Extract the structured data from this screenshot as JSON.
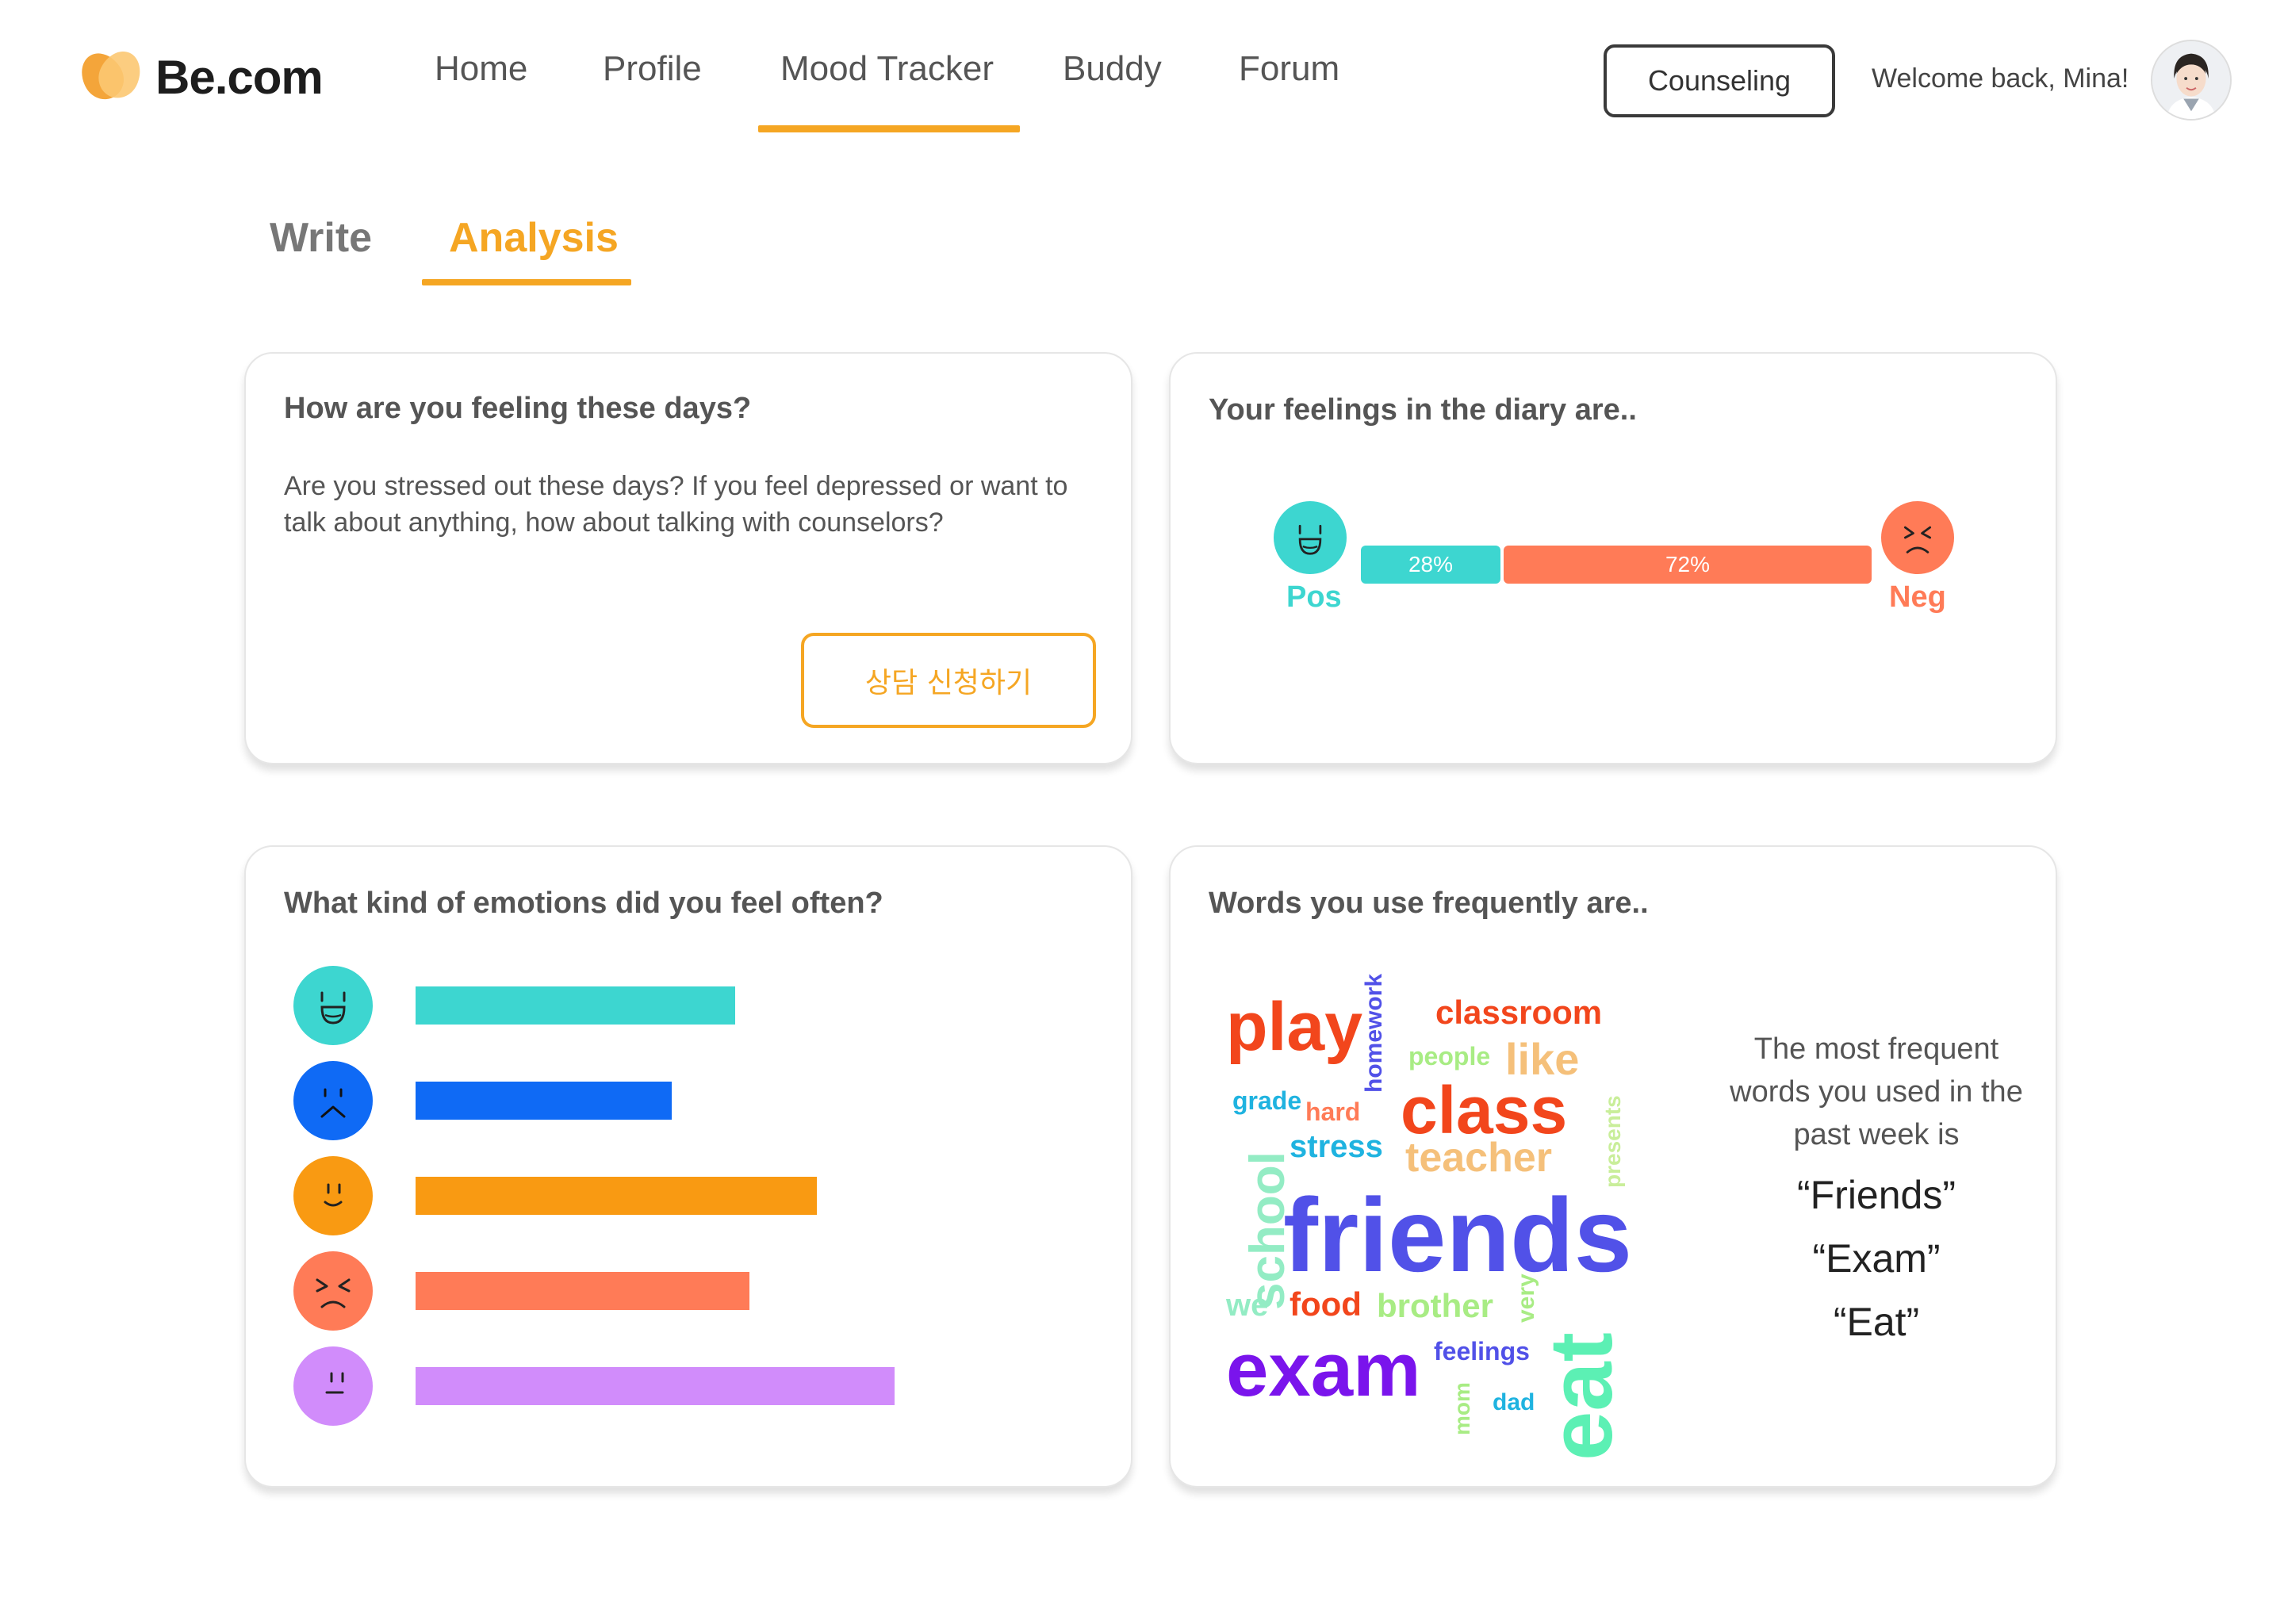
{
  "brand": {
    "name": "Be.com"
  },
  "nav": {
    "items": [
      {
        "label": "Home"
      },
      {
        "label": "Profile"
      },
      {
        "label": "Mood Tracker"
      },
      {
        "label": "Buddy"
      },
      {
        "label": "Forum"
      }
    ],
    "active_index": 2
  },
  "header": {
    "counseling_label": "Counseling",
    "welcome_text": "Welcome back, Mina!"
  },
  "subtabs": {
    "items": [
      {
        "label": "Write"
      },
      {
        "label": "Analysis"
      }
    ],
    "active_index": 1
  },
  "feeling_card": {
    "title": "How are you feeling these days?",
    "description": "Are you stressed out these days? If you feel depressed or want to talk about anything, how about talking with counselors?",
    "button_label": "상담 신청하기"
  },
  "diary_card": {
    "title": "Your feelings in the diary are..",
    "positive": {
      "label": "Pos",
      "percent": 28,
      "percent_text": "28%",
      "color": "#3dd6d0",
      "icon": "grinning-face-icon"
    },
    "negative": {
      "label": "Neg",
      "percent": 72,
      "percent_text": "72%",
      "color": "#ff7b57",
      "icon": "angry-face-icon"
    }
  },
  "emotions_card": {
    "title": "What kind of emotions did you feel often?",
    "chart_data": {
      "type": "bar",
      "orientation": "horizontal",
      "categories": [
        "happy",
        "sad",
        "calm",
        "angry",
        "neutral"
      ],
      "values": [
        0.66,
        0.53,
        0.83,
        0.69,
        0.99
      ],
      "colors": [
        "#3dd6d0",
        "#0f6af5",
        "#f99a12",
        "#ff7b57",
        "#d18cfb"
      ],
      "icons": [
        "grinning-face-icon",
        "sad-face-icon",
        "smiling-face-icon",
        "angry-face-icon",
        "neutral-face-icon"
      ],
      "xlim": [
        0,
        1
      ],
      "grid": false
    }
  },
  "words_card": {
    "title": "Words you use frequently are..",
    "cloud": [
      {
        "text": "play",
        "color": "#f2461c"
      },
      {
        "text": "homework",
        "color": "#5151e8"
      },
      {
        "text": "classroom",
        "color": "#f2461c"
      },
      {
        "text": "people",
        "color": "#a8ec84"
      },
      {
        "text": "like",
        "color": "#f5c07a"
      },
      {
        "text": "presents",
        "color": "#c9ee9a"
      },
      {
        "text": "grade",
        "color": "#1fb3e0"
      },
      {
        "text": "hard",
        "color": "#ff7b57"
      },
      {
        "text": "class",
        "color": "#f2461c"
      },
      {
        "text": "stress",
        "color": "#1fb3e0"
      },
      {
        "text": "teacher",
        "color": "#f5c07a"
      },
      {
        "text": "school",
        "color": "#93ecc4"
      },
      {
        "text": "friends",
        "color": "#5151e8"
      },
      {
        "text": "we",
        "color": "#93ecc4"
      },
      {
        "text": "food",
        "color": "#f2461c"
      },
      {
        "text": "brother",
        "color": "#a8ec84"
      },
      {
        "text": "very",
        "color": "#a8ec84"
      },
      {
        "text": "eat",
        "color": "#5cf0b4"
      },
      {
        "text": "exam",
        "color": "#7a14ec"
      },
      {
        "text": "feelings",
        "color": "#5151e8"
      },
      {
        "text": "mom",
        "color": "#a8ec84"
      },
      {
        "text": "dad",
        "color": "#1fb3e0"
      }
    ],
    "summary": "The most frequent words you used in the past week is",
    "top_words": [
      "“Friends”",
      "“Exam”",
      "“Eat”"
    ]
  }
}
